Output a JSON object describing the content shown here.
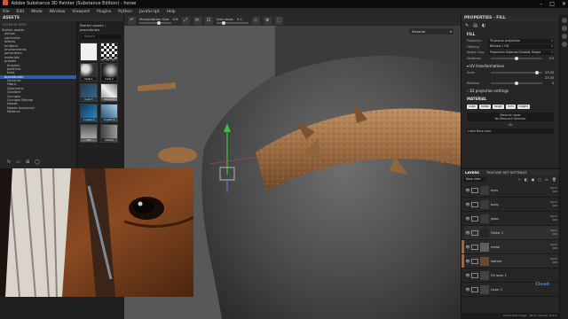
{
  "window": {
    "title": "Adobe Substance 3D Painter (Substance Edition) - horse",
    "controls": [
      "–",
      "□",
      "✕"
    ]
  },
  "menu": [
    "File",
    "Edit",
    "Mode",
    "Window",
    "Viewport",
    "Plugins",
    "Python",
    "JavaScript",
    "Help"
  ],
  "assets": {
    "title": "ASSETS",
    "filter_label": "FILTER BY PATH",
    "tree": [
      "Starter assets",
      "alphas",
      "concretes",
      "effects",
      "emitters",
      "environments",
      "generators",
      "materials",
      "presets",
      "brushes",
      "particles",
      "tools",
      "procedurals",
      "Dynamic",
      "Fabric",
      "Geometric",
      "Gradient",
      "Grunges",
      "Grunges Bitmap",
      "Noises",
      "Noises Advanced",
      "Patterns"
    ],
    "selected_index": 12,
    "browser": {
      "breadcrumb": "Starter assets › procedurals",
      "search_placeholder": "Search",
      "thumbs": [
        "",
        "Checker 2",
        "Cells 1",
        "Cells 2",
        "Cells 3",
        "Clouds 1",
        "Crystal 1",
        "Crystal 2",
        "Dirt",
        "Dust 2"
      ]
    },
    "bottom_icons": [
      "↻",
      "▭",
      "⊞",
      "◯"
    ]
  },
  "toolbar": {
    "manip_label": "Manipulation Size",
    "manip_value": "0.6",
    "grid_label": "Grid steps",
    "grid_value": "0.1",
    "icons": [
      "↶",
      "⤢",
      "⟳",
      "⊡",
      "⊹",
      "⊕",
      "⬚"
    ]
  },
  "viewport": {
    "mode_select": "Material"
  },
  "properties": {
    "title": "PROPERTIES - FILL",
    "fill_label": "FILL",
    "projection_label": "Projection",
    "projection_value": "Tri-planar projection",
    "filtering_label": "Filtering",
    "filtering_value": "Bilinear | HQ",
    "shape_label": "Shape Crop",
    "shape_value": "Projection Extends Outside Shape",
    "hardness_label": "Hardness",
    "hardness_value": "0.5",
    "hardness_level": 0.5,
    "uv_label": "UV transformations",
    "scale_label": "Scale",
    "scale_value_a": "25.35",
    "scale_value_b": "25.35",
    "scale_level": 0.9,
    "rotation_label": "Rotation",
    "rotation_value": "0",
    "rotation_level": 0.5,
    "settings3d_label": "3D projection settings",
    "material_label": "MATERIAL",
    "channels": [
      "color",
      "metal",
      "rough",
      "nrm",
      "height"
    ],
    "material_mode": "Material mode",
    "no_resource": "No Resource Selected",
    "or_label": "Or",
    "layer_preset": "Lathe Base color"
  },
  "layers": {
    "tabs": [
      "LAYERS",
      "TEXTURE SET SETTINGS"
    ],
    "blend_mode": "Base color",
    "rows": [
      {
        "name": "eyes",
        "blend": "Norm",
        "opacity": "100",
        "thumb": "#3a3a3a",
        "swatch": "#262626"
      },
      {
        "name": "body",
        "blend": "Norm",
        "opacity": "100",
        "thumb": "#3a3a3a",
        "swatch": "#262626"
      },
      {
        "name": "glass",
        "blend": "Norm",
        "opacity": "100",
        "thumb": "#3a3a3a",
        "swatch": "#262626"
      },
      {
        "name": "Folder 1",
        "blend": "Norm",
        "opacity": "100",
        "thumb": "#262626",
        "swatch": "#262626"
      },
      {
        "name": "metal",
        "blend": "Norm",
        "opacity": "100",
        "thumb": "#5b5f66",
        "swatch": "#9a6a44"
      },
      {
        "name": "leather",
        "blend": "Norm",
        "opacity": "100",
        "thumb": "#6a4a2e",
        "swatch": "#9a6a44"
      },
      {
        "name": "Fill layer 1",
        "blend": "",
        "opacity": "",
        "thumb": "#444",
        "swatch": "#262626"
      },
      {
        "name": "Layer 1",
        "blend": "",
        "opacity": "",
        "thumb": "#444",
        "swatch": "#262626"
      }
    ],
    "status": "Cache Disk Usage : 84% | Version: 9.0.0"
  },
  "watermark": "Cloud",
  "colors": {
    "accent": "#2e5ea8",
    "viewport_bg": "#5a5a5a",
    "leather": "#a8774c"
  }
}
